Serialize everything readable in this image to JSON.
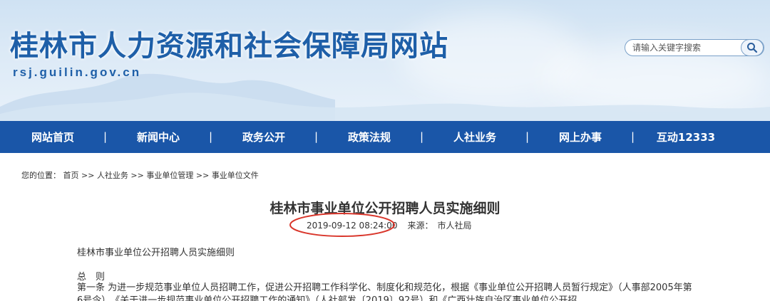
{
  "site": {
    "title": "桂林市人力资源和社会保障局网站",
    "domain": "rsj.guilin.gov.cn"
  },
  "search": {
    "placeholder": "请输入关键字搜索",
    "icon": "search-icon"
  },
  "nav": {
    "items": [
      {
        "label": "网站首页"
      },
      {
        "label": "新闻中心"
      },
      {
        "label": "政务公开"
      },
      {
        "label": "政策法规"
      },
      {
        "label": "人社业务"
      },
      {
        "label": "网上办事"
      },
      {
        "label": "互动12333"
      }
    ],
    "separator": "|"
  },
  "breadcrumb": {
    "prefix": "您的位置：",
    "items": [
      "首页",
      "人社业务",
      "事业单位管理",
      "事业单位文件"
    ],
    "sep": " >> "
  },
  "article": {
    "title": "桂林市事业单位公开招聘人员实施细则",
    "date": "2019-09-12 08:24:00",
    "source_label": "来源：",
    "source_value": "市人社局",
    "body": [
      "桂林市事业单位公开招聘人员实施细则",
      "总　则",
      "第一条 为进一步规范事业单位人员招聘工作，促进公开招聘工作科学化、制度化和规范化，根据《事业单位公开招聘人员暂行规定》（人事部2005年第6号令）、《关于进一步规范事业单位公开招聘工作的通知》（人社部发〔2019〕92号）和《广西壮族自治区事业单位公开招"
    ]
  },
  "colors": {
    "nav_bg": "#1a56a8",
    "title_blue": "#1e5fa8",
    "highlight_red": "#d9362b"
  }
}
